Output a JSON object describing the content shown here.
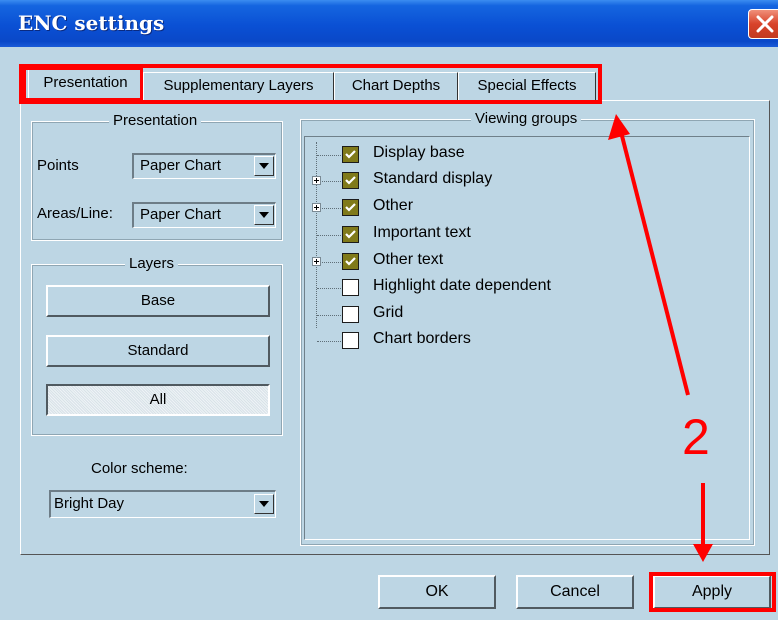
{
  "window": {
    "title": "ENC settings"
  },
  "tabs": [
    {
      "label": "Presentation",
      "active": true
    },
    {
      "label": "Supplementary Layers",
      "active": false
    },
    {
      "label": "Chart Depths",
      "active": false
    },
    {
      "label": "Special Effects",
      "active": false
    }
  ],
  "presentation_group": {
    "title": "Presentation",
    "points_label": "Points",
    "points_value": "Paper Chart",
    "areas_label": "Areas/Line:",
    "areas_value": "Paper Chart"
  },
  "layers_group": {
    "title": "Layers",
    "buttons": [
      {
        "label": "Base",
        "pressed": false
      },
      {
        "label": "Standard",
        "pressed": false
      },
      {
        "label": "All",
        "pressed": true
      }
    ]
  },
  "color_scheme": {
    "label": "Color scheme:",
    "value": "Bright Day"
  },
  "viewing_groups": {
    "title": "Viewing groups",
    "items": [
      {
        "label": "Display base",
        "checked": true,
        "expandable": false
      },
      {
        "label": "Standard display",
        "checked": true,
        "expandable": true
      },
      {
        "label": "Other",
        "checked": true,
        "expandable": true
      },
      {
        "label": "Important text",
        "checked": true,
        "expandable": false
      },
      {
        "label": "Other text",
        "checked": true,
        "expandable": true
      },
      {
        "label": "Highlight date dependent",
        "checked": false,
        "expandable": false
      },
      {
        "label": "Grid",
        "checked": false,
        "expandable": false
      },
      {
        "label": "Chart borders",
        "checked": false,
        "expandable": false
      }
    ]
  },
  "footer": {
    "ok_label": "OK",
    "cancel_label": "Cancel",
    "apply_label": "Apply"
  },
  "annotation": {
    "step_number": "2",
    "color": "#ff0000"
  },
  "colors": {
    "dialog_bg": "#bdd6e4",
    "titlebar": "#0a50d4",
    "checkbox_checked": "#807a1a"
  }
}
